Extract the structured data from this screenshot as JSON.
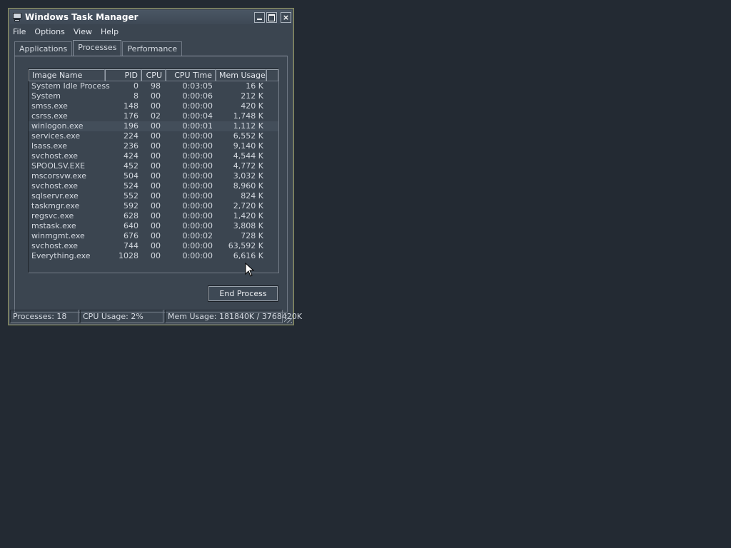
{
  "window": {
    "title": "Windows Task Manager",
    "icon": "task-manager-monitor-icon",
    "controls": {
      "minimize": "",
      "maximize": "",
      "close": "×"
    }
  },
  "menu": [
    "File",
    "Options",
    "View",
    "Help"
  ],
  "tabs": [
    {
      "label": "Applications",
      "active": false
    },
    {
      "label": "Processes",
      "active": true
    },
    {
      "label": "Performance",
      "active": false
    }
  ],
  "process_table": {
    "columns": [
      "Image Name",
      "PID",
      "CPU",
      "CPU Time",
      "Mem Usage"
    ],
    "rows": [
      [
        "System Idle Process",
        "0",
        "98",
        "0:03:05",
        "16 K"
      ],
      [
        "System",
        "8",
        "00",
        "0:00:06",
        "212 K"
      ],
      [
        "smss.exe",
        "148",
        "00",
        "0:00:00",
        "420 K"
      ],
      [
        "csrss.exe",
        "176",
        "02",
        "0:00:04",
        "1,748 K"
      ],
      [
        "winlogon.exe",
        "196",
        "00",
        "0:00:01",
        "1,112 K"
      ],
      [
        "services.exe",
        "224",
        "00",
        "0:00:00",
        "6,552 K"
      ],
      [
        "lsass.exe",
        "236",
        "00",
        "0:00:00",
        "9,140 K"
      ],
      [
        "svchost.exe",
        "424",
        "00",
        "0:00:00",
        "4,544 K"
      ],
      [
        "SPOOLSV.EXE",
        "452",
        "00",
        "0:00:00",
        "4,772 K"
      ],
      [
        "mscorsvw.exe",
        "504",
        "00",
        "0:00:00",
        "3,032 K"
      ],
      [
        "svchost.exe",
        "524",
        "00",
        "0:00:00",
        "8,960 K"
      ],
      [
        "sqlservr.exe",
        "552",
        "00",
        "0:00:00",
        "824 K"
      ],
      [
        "taskmgr.exe",
        "592",
        "00",
        "0:00:00",
        "2,720 K"
      ],
      [
        "regsvc.exe",
        "628",
        "00",
        "0:00:00",
        "1,420 K"
      ],
      [
        "mstask.exe",
        "640",
        "00",
        "0:00:00",
        "3,808 K"
      ],
      [
        "winmgmt.exe",
        "676",
        "00",
        "0:00:02",
        "728 K"
      ],
      [
        "svchost.exe",
        "744",
        "00",
        "0:00:00",
        "63,592 K"
      ],
      [
        "Everything.exe",
        "1028",
        "00",
        "0:00:00",
        "6,616 K"
      ]
    ],
    "highlighted_row": 4
  },
  "end_process_label": "End Process",
  "status": {
    "processes": "Processes: 18",
    "cpu": "CPU Usage: 2%",
    "mem": "Mem Usage: 181840K / 3768420K"
  },
  "colors": {
    "desktop": "#232a33",
    "window": "#3b4550",
    "border_accent": "#8a8f5a",
    "text": "#d6dbe2"
  }
}
